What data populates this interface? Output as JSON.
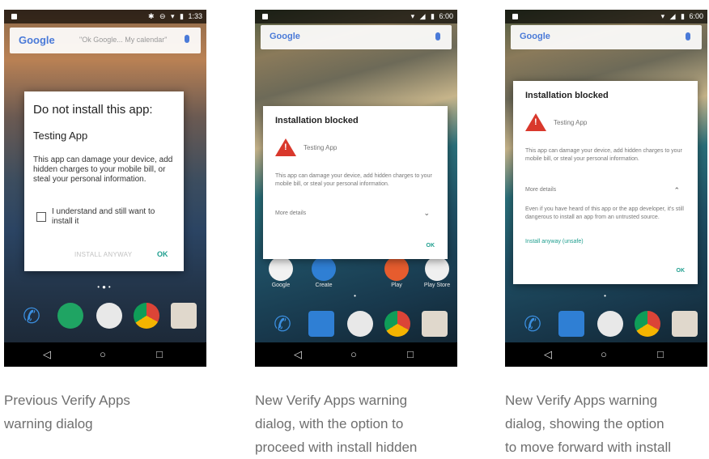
{
  "phones": [
    {
      "status_time": "1:33",
      "search": {
        "logo": "Google",
        "hint": "\"Ok Google... My calendar\""
      },
      "dialog": {
        "title": "Do not install this app:",
        "app_name": "Testing App",
        "message": "This app can damage your device, add hidden charges to your mobile bill, or steal your personal information.",
        "checkbox_label": "I understand and still want to install it",
        "install_anyway": "INSTALL ANYWAY",
        "ok": "OK"
      },
      "caption": [
        "Previous Verify Apps",
        "warning dialog"
      ]
    },
    {
      "status_time": "6:00",
      "search": {
        "logo": "Google"
      },
      "home_labels": [
        "Google",
        "Create",
        "Play",
        "Play Store"
      ],
      "dialog": {
        "title": "Installation blocked",
        "app_name": "Testing App",
        "message": "This app can damage your device, add hidden charges to your mobile bill, or steal your personal information.",
        "more_details": "More details",
        "ok": "OK"
      },
      "caption": [
        "New Verify Apps warning",
        "dialog, with the option to",
        "proceed with install hidden"
      ]
    },
    {
      "status_time": "6:00",
      "search": {
        "logo": "Google"
      },
      "dialog": {
        "title": "Installation blocked",
        "app_name": "Testing App",
        "message": "This app can damage your device, add hidden charges to your mobile bill, or steal your personal information.",
        "more_details": "More details",
        "extra": "Even if you have heard of this app or the app developer, it's still dangerous to install an app from an untrusted source.",
        "install_anyway": "Install anyway (unsafe)",
        "ok": "OK"
      },
      "caption": [
        "New Verify Apps warning",
        "dialog, showing the option",
        "to move forward with install"
      ]
    }
  ],
  "colors": {
    "accent": "#1e9e8e",
    "warning": "#d9382c"
  },
  "icons": [
    "wifi-icon",
    "signal-icon",
    "battery-icon",
    "mic-icon",
    "phone-icon",
    "chrome-icon",
    "camera-icon",
    "back-icon",
    "home-icon",
    "recents-icon",
    "apps-icon",
    "chevron-down-icon",
    "chevron-up-icon",
    "warning-icon"
  ]
}
